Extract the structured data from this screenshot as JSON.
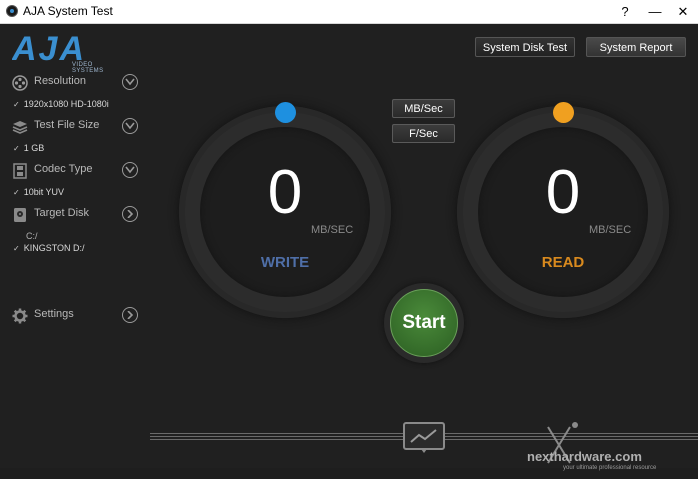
{
  "window": {
    "title": "AJA System Test",
    "help_label": "?",
    "minimize_label": "—",
    "close_label": "✕"
  },
  "logo": {
    "text": "AJA",
    "sub": "VIDEO SYSTEMS",
    "color": "#3a8fd0"
  },
  "header_buttons": {
    "disk_test": "System Disk Test",
    "report": "System Report"
  },
  "sidebar": {
    "resolution": {
      "label": "Resolution",
      "value": "1920x1080 HD-1080i",
      "icon": "film-reel-icon"
    },
    "file_size": {
      "label": "Test File Size",
      "value": "1 GB",
      "icon": "stack-icon"
    },
    "codec": {
      "label": "Codec Type",
      "value": "10bit YUV",
      "icon": "film-strip-icon"
    },
    "target": {
      "label": "Target Disk",
      "path": "C:/",
      "value": "KINGSTON D:/",
      "icon": "disk-icon"
    },
    "settings": {
      "label": "Settings",
      "icon": "gear-icon"
    },
    "check": "✓"
  },
  "units": {
    "mbs": "MB/Sec",
    "fps": "F/Sec"
  },
  "write": {
    "value": "0",
    "unit": "MB/SEC",
    "label": "WRITE",
    "color": "#4f6fa8",
    "knob_color": "#1e90e0"
  },
  "read": {
    "value": "0",
    "unit": "MB/SEC",
    "label": "READ",
    "color": "#d98a1e",
    "knob_color": "#f0a020"
  },
  "start": {
    "label": "Start",
    "color": "#3a7a2e"
  },
  "watermark": {
    "text": "nexthardware.com",
    "tagline": "your ultimate professional resource"
  }
}
